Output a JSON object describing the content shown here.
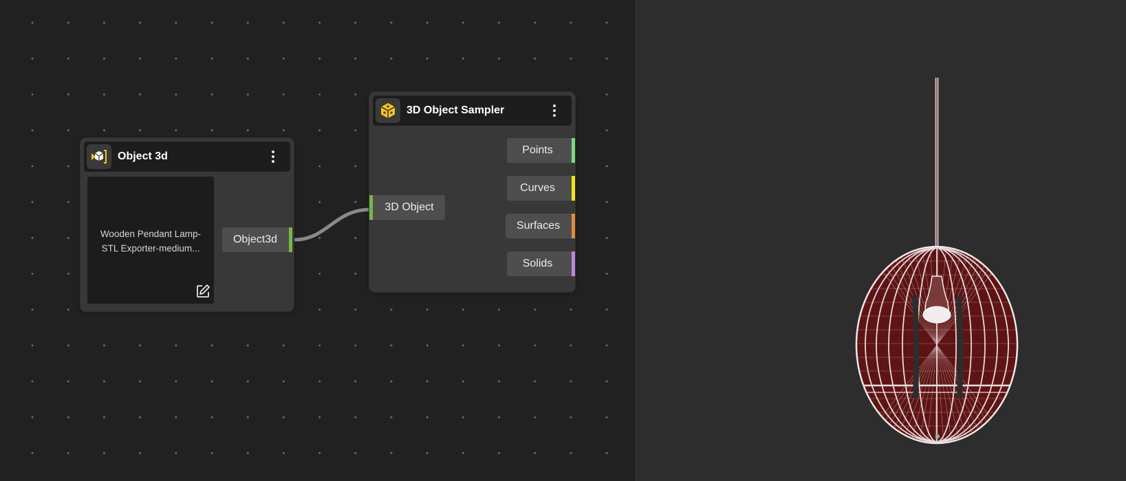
{
  "node_object3d": {
    "title": "Object 3d",
    "preview_line1": "Wooden Pendant Lamp-",
    "preview_line2": "STL Exporter-medium...",
    "output_port": "Object3d"
  },
  "node_sampler": {
    "title": "3D Object Sampler",
    "input_port": "3D Object",
    "outputs": [
      {
        "label": "Points",
        "color": "#7ed880"
      },
      {
        "label": "Curves",
        "color": "#f2e417"
      },
      {
        "label": "Surfaces",
        "color": "#e38a3c"
      },
      {
        "label": "Solids",
        "color": "#b98ad6"
      }
    ]
  },
  "colors": {
    "input_port_bar": "#76b844",
    "output_port_bar": "#76b844",
    "icon_accent": "#f5c517",
    "link": "#8a8a8a",
    "model_fill": "#5e1414",
    "model_wire": "#f2e8e8"
  },
  "icons": {
    "object3d": "cube-import-icon",
    "sampler": "sampler-network-icon",
    "menu": "vertical-dots-icon",
    "edit": "pencil-edit-icon"
  },
  "viewport": {
    "model": "wooden-pendant-lamp-wireframe"
  }
}
